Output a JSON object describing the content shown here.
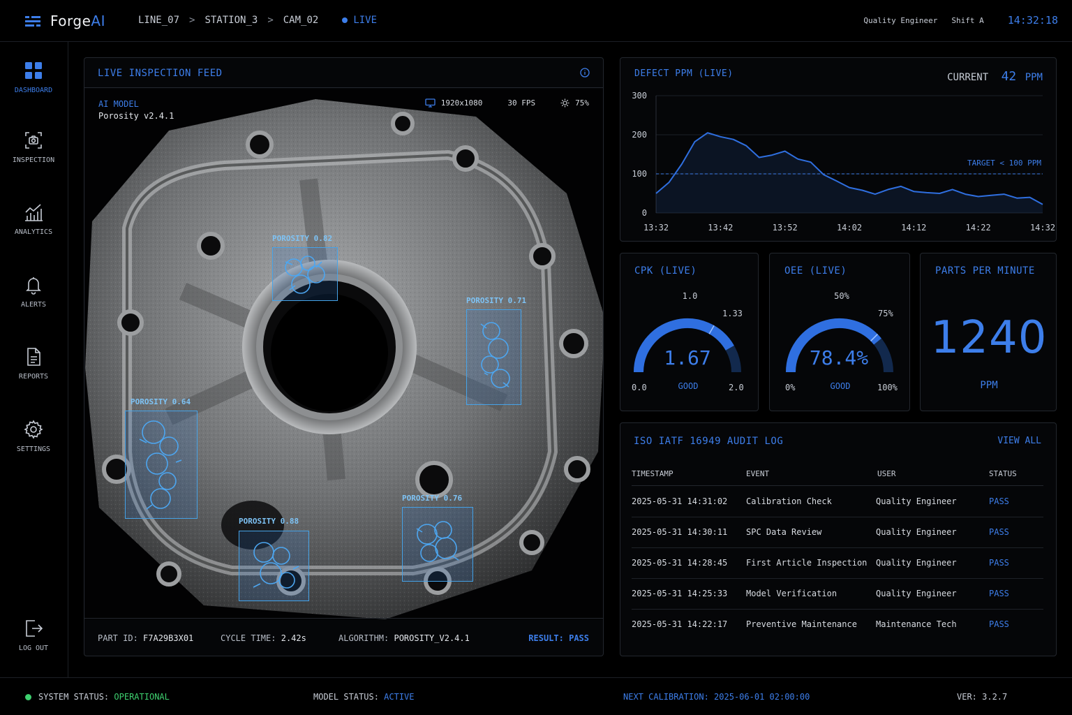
{
  "app": {
    "name_prefix": "Forge",
    "name_suffix": "AI"
  },
  "breadcrumb": {
    "line": "LINE_07",
    "station": "STATION_3",
    "camera": "CAM_02",
    "live": "LIVE"
  },
  "header": {
    "role": "Quality Engineer",
    "shift": "Shift A",
    "time": "14:32:18"
  },
  "sidebar": {
    "items": [
      {
        "label": "DASHBOARD",
        "icon": "grid-icon"
      },
      {
        "label": "INSPECTION",
        "icon": "camera-scan-icon"
      },
      {
        "label": "ANALYTICS",
        "icon": "chart-icon"
      },
      {
        "label": "ALERTS",
        "icon": "bell-icon"
      },
      {
        "label": "REPORTS",
        "icon": "document-icon"
      },
      {
        "label": "SETTINGS",
        "icon": "gear-icon"
      }
    ],
    "logout": "LOG OUT"
  },
  "feed": {
    "title": "LIVE INSPECTION FEED",
    "model_key": "AI MODEL",
    "model_value": "Porosity v2.4.1",
    "resolution": "1920x1080",
    "fps": "30 FPS",
    "brightness": "75%",
    "detections": [
      {
        "label": "POROSITY 0.82"
      },
      {
        "label": "POROSITY 0.71"
      },
      {
        "label": "POROSITY 0.64"
      },
      {
        "label": "POROSITY 0.88"
      },
      {
        "label": "POROSITY 0.76"
      }
    ],
    "footer": {
      "part_key": "PART ID:",
      "part_value": "F7A29B3X01",
      "cycle_key": "CYCLE TIME:",
      "cycle_value": "2.42s",
      "algo_key": "ALGORITHM:",
      "algo_value": "POROSITY_V2.4.1",
      "result": "RESULT: PASS"
    }
  },
  "ppm": {
    "title": "DEFECT PPM (LIVE)",
    "current_label": "CURRENT",
    "current_value": "42",
    "current_unit": "PPM",
    "target_label": "TARGET < 100 PPM"
  },
  "chart_data": {
    "type": "line",
    "title": "DEFECT PPM (LIVE)",
    "xlabel": "",
    "ylabel": "",
    "ylim": [
      0,
      300
    ],
    "yticks": [
      "300",
      "200",
      "100",
      "0"
    ],
    "xticks": [
      "13:32",
      "13:42",
      "13:52",
      "14:02",
      "14:12",
      "14:22",
      "14:32"
    ],
    "target": 100,
    "grid": true,
    "x": [
      "13:32",
      "13:34",
      "13:36",
      "13:38",
      "13:40",
      "13:42",
      "13:44",
      "13:46",
      "13:48",
      "13:50",
      "13:52",
      "13:54",
      "13:56",
      "13:58",
      "14:00",
      "14:02",
      "14:04",
      "14:06",
      "14:08",
      "14:10",
      "14:12",
      "14:14",
      "14:16",
      "14:18",
      "14:20",
      "14:22",
      "14:24",
      "14:26",
      "14:28",
      "14:30",
      "14:32"
    ],
    "series": [
      {
        "values": [
          50,
          78,
          125,
          182,
          205,
          195,
          188,
          172,
          142,
          148,
          158,
          138,
          130,
          98,
          82,
          65,
          58,
          48,
          60,
          68,
          55,
          52,
          50,
          60,
          48,
          42,
          45,
          48,
          38,
          40,
          22
        ]
      }
    ]
  },
  "cpk": {
    "title": "CPK (LIVE)",
    "value": "1.67",
    "status": "GOOD",
    "min": "0.0",
    "max": "2.0",
    "mid": "1.0",
    "threshold": "1.33",
    "level": 0.835
  },
  "oee": {
    "title": "OEE (LIVE)",
    "value": "78.4%",
    "status": "GOOD",
    "min": "0%",
    "max": "100%",
    "mid": "50%",
    "threshold": "75%",
    "level": 0.784
  },
  "parts": {
    "title": "PARTS PER MINUTE",
    "value": "1240",
    "unit": "PPM"
  },
  "audit": {
    "title": "ISO IATF 16949 AUDIT LOG",
    "view_all": "VIEW ALL",
    "columns": [
      "TIMESTAMP",
      "EVENT",
      "USER",
      "STATUS"
    ],
    "rows": [
      [
        "2025-05-31 14:31:02",
        "Calibration Check",
        "Quality Engineer",
        "PASS"
      ],
      [
        "2025-05-31 14:30:11",
        "SPC Data Review",
        "Quality Engineer",
        "PASS"
      ],
      [
        "2025-05-31 14:28:45",
        "First Article Inspection",
        "Quality Engineer",
        "PASS"
      ],
      [
        "2025-05-31 14:25:33",
        "Model Verification",
        "Quality Engineer",
        "PASS"
      ],
      [
        "2025-05-31 14:22:17",
        "Preventive Maintenance",
        "Maintenance Tech",
        "PASS"
      ]
    ]
  },
  "status": {
    "system_key": "SYSTEM STATUS:",
    "system_value": "OPERATIONAL",
    "model_key": "MODEL STATUS:",
    "model_value": "ACTIVE",
    "calibration": "NEXT CALIBRATION: 2025-06-01 02:00:00",
    "version": "VER: 3.2.7"
  },
  "colors": {
    "accent": "#3d7eea",
    "ok": "#3ed06f",
    "bbox": "#46a3e8",
    "background": "#000000"
  }
}
